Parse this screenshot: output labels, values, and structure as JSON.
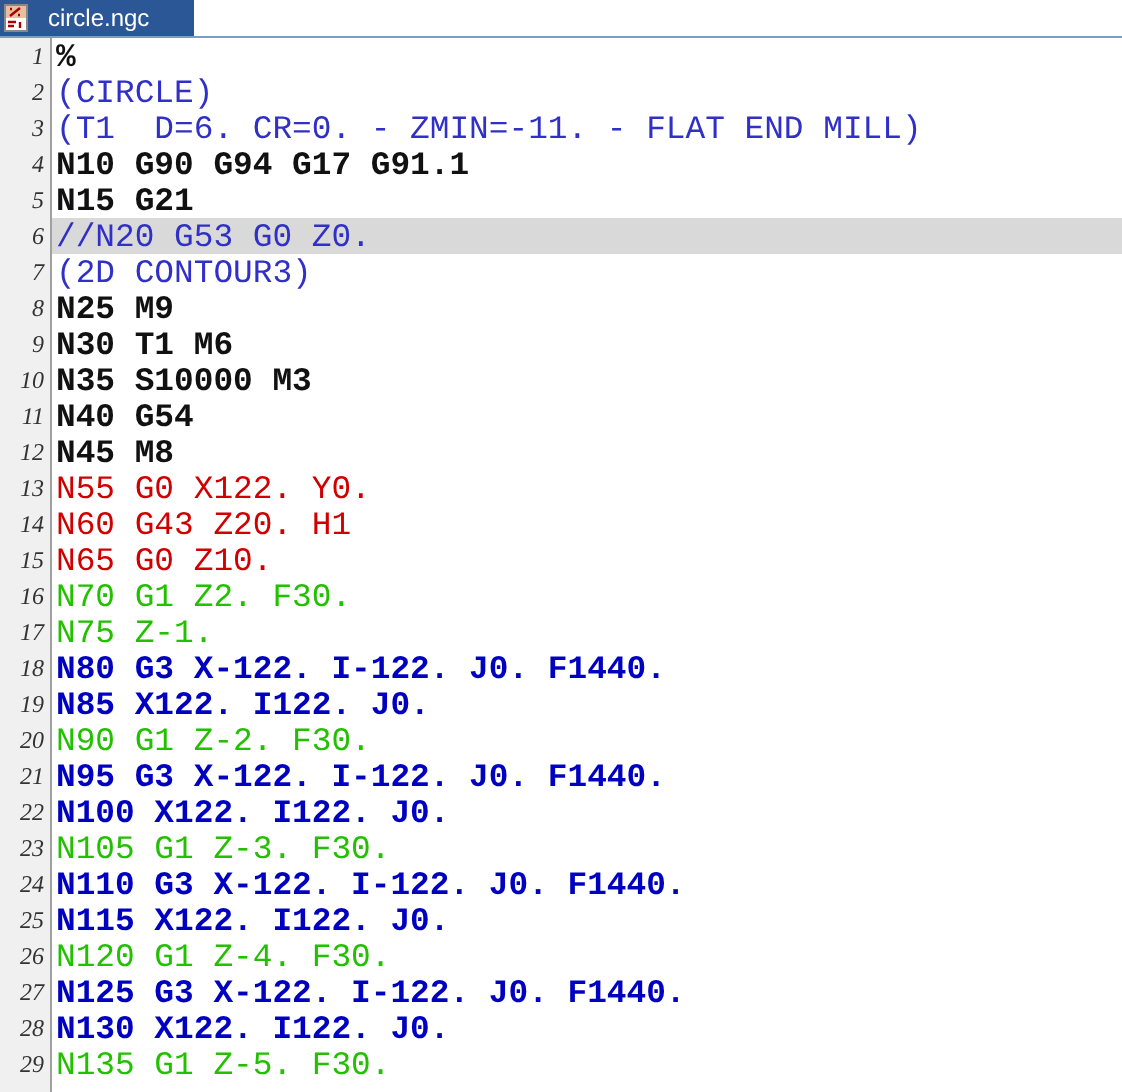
{
  "tabs": [
    {
      "label": "circle.ngc",
      "selected": true
    }
  ],
  "editor": {
    "lines": [
      {
        "number": "1",
        "text": "%",
        "kind": "code",
        "current": false
      },
      {
        "number": "2",
        "text": "(CIRCLE)",
        "kind": "comment",
        "current": false
      },
      {
        "number": "3",
        "text": "(T1  D=6. CR=0. - ZMIN=-11. - FLAT END MILL)",
        "kind": "comment",
        "current": false
      },
      {
        "number": "4",
        "text": "N10 G90 G94 G17 G91.1",
        "kind": "code",
        "current": false
      },
      {
        "number": "5",
        "text": "N15 G21",
        "kind": "code",
        "current": false
      },
      {
        "number": "6",
        "text": "//N20 G53 G0 Z0.",
        "kind": "comment",
        "current": true
      },
      {
        "number": "7",
        "text": "(2D CONTOUR3)",
        "kind": "comment",
        "current": false
      },
      {
        "number": "8",
        "text": "N25 M9",
        "kind": "code",
        "current": false
      },
      {
        "number": "9",
        "text": "N30 T1 M6",
        "kind": "code",
        "current": false
      },
      {
        "number": "10",
        "text": "N35 S10000 M3",
        "kind": "code",
        "current": false
      },
      {
        "number": "11",
        "text": "N40 G54",
        "kind": "code",
        "current": false
      },
      {
        "number": "12",
        "text": "N45 M8",
        "kind": "code",
        "current": false
      },
      {
        "number": "13",
        "text": "N55 G0 X122. Y0.",
        "kind": "rapid",
        "current": false
      },
      {
        "number": "14",
        "text": "N60 G43 Z20. H1",
        "kind": "rapid",
        "current": false
      },
      {
        "number": "15",
        "text": "N65 G0 Z10.",
        "kind": "rapid",
        "current": false
      },
      {
        "number": "16",
        "text": "N70 G1 Z2. F30.",
        "kind": "feed",
        "current": false
      },
      {
        "number": "17",
        "text": "N75 Z-1.",
        "kind": "feed",
        "current": false
      },
      {
        "number": "18",
        "text": "N80 G3 X-122. I-122. J0. F1440.",
        "kind": "arc",
        "current": false
      },
      {
        "number": "19",
        "text": "N85 X122. I122. J0.",
        "kind": "arc",
        "current": false
      },
      {
        "number": "20",
        "text": "N90 G1 Z-2. F30.",
        "kind": "feed",
        "current": false
      },
      {
        "number": "21",
        "text": "N95 G3 X-122. I-122. J0. F1440.",
        "kind": "arc",
        "current": false
      },
      {
        "number": "22",
        "text": "N100 X122. I122. J0.",
        "kind": "arc",
        "current": false
      },
      {
        "number": "23",
        "text": "N105 G1 Z-3. F30.",
        "kind": "feed",
        "current": false
      },
      {
        "number": "24",
        "text": "N110 G3 X-122. I-122. J0. F1440.",
        "kind": "arc",
        "current": false
      },
      {
        "number": "25",
        "text": "N115 X122. I122. J0.",
        "kind": "arc",
        "current": false
      },
      {
        "number": "26",
        "text": "N120 G1 Z-4. F30.",
        "kind": "feed",
        "current": false
      },
      {
        "number": "27",
        "text": "N125 G3 X-122. I-122. J0. F1440.",
        "kind": "arc",
        "current": false
      },
      {
        "number": "28",
        "text": "N130 X122. I122. J0.",
        "kind": "arc",
        "current": false
      },
      {
        "number": "29",
        "text": "N135 G1 Z-5. F30.",
        "kind": "feed",
        "current": false
      }
    ]
  }
}
